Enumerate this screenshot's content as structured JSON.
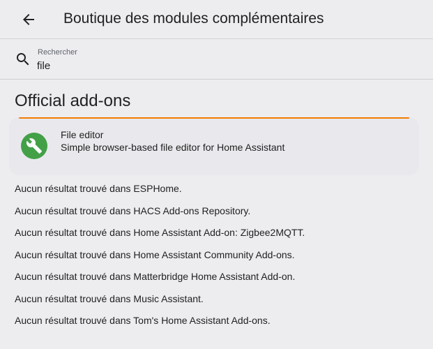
{
  "header": {
    "back_icon": "arrow-left-icon",
    "title": "Boutique des modules complémentaires"
  },
  "search": {
    "icon": "search-icon",
    "label": "Rechercher",
    "value": "file"
  },
  "section": {
    "title": "Official add-ons"
  },
  "addons": [
    {
      "icon": "wrench-icon",
      "icon_color": "#43a047",
      "accent_color": "#f57c00",
      "name": "File editor",
      "description": "Simple browser-based file editor for Home Assistant"
    }
  ],
  "no_results": [
    "Aucun résultat trouvé dans ESPHome.",
    "Aucun résultat trouvé dans HACS Add-ons Repository.",
    "Aucun résultat trouvé dans Home Assistant Add-on: Zigbee2MQTT.",
    "Aucun résultat trouvé dans Home Assistant Community Add-ons.",
    "Aucun résultat trouvé dans Matterbridge Home Assistant Add-on.",
    "Aucun résultat trouvé dans Music Assistant.",
    "Aucun résultat trouvé dans Tom's Home Assistant Add-ons."
  ]
}
